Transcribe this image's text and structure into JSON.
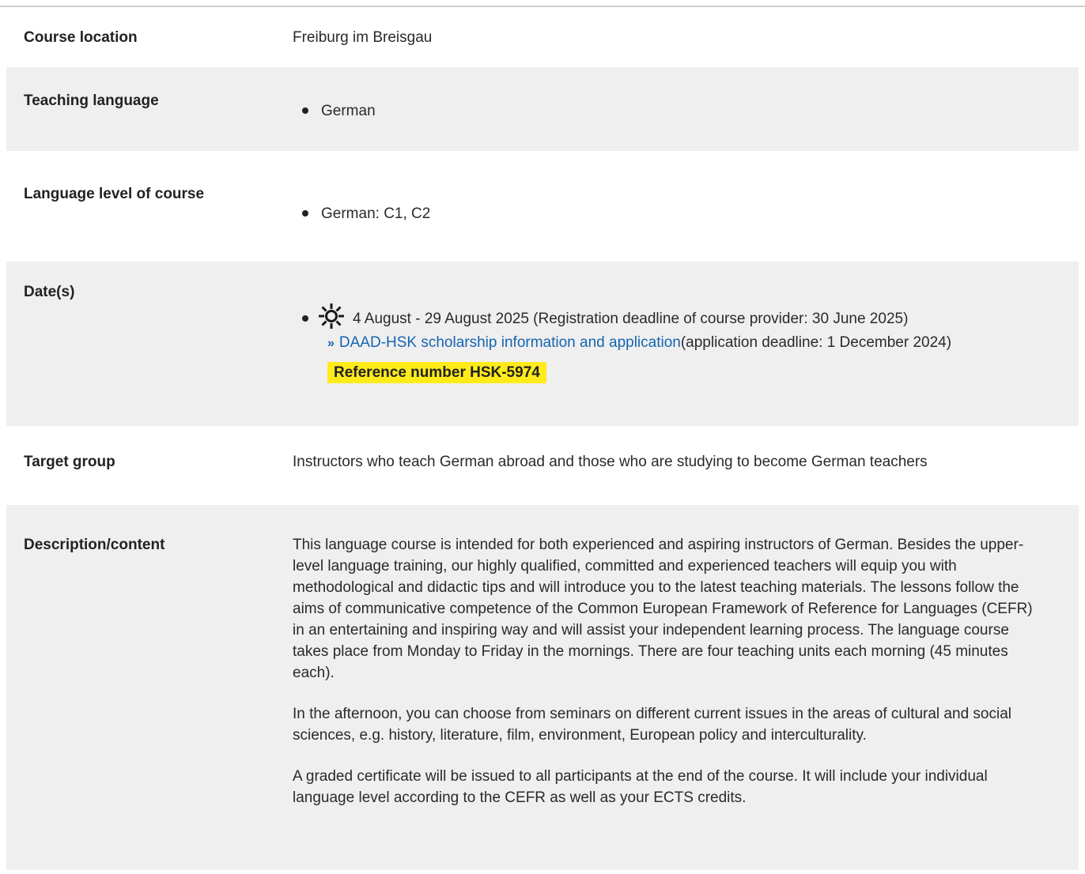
{
  "rows": {
    "location": {
      "label": "Course location",
      "value": "Freiburg im Breisgau"
    },
    "teaching_language": {
      "label": "Teaching language",
      "items": [
        "German"
      ]
    },
    "language_level": {
      "label": "Language level of course",
      "items": [
        "German: C1, C2"
      ]
    },
    "dates": {
      "label": "Date(s)",
      "icon": "sun-icon",
      "date_text": "4 August - 29 August 2025 (Registration deadline of course provider: 30 June 2025)",
      "link_arrow": "»",
      "link_text": "DAAD-HSK scholarship information and application",
      "link_suffix": "(application deadline: 1 December 2024)",
      "reference": "Reference number HSK-5974"
    },
    "target_group": {
      "label": "Target group",
      "value": "Instructors who teach German abroad and those who are studying to become German teachers"
    },
    "description": {
      "label": "Description/content",
      "paragraphs": [
        "This language course is intended for both experienced and aspiring instructors of German. Besides the upper-level language training, our highly qualified, committed and experienced teachers will equip you with methodological and didactic tips and will introduce you to the latest teaching materials. The lessons follow the aims of communicative competence of the Common European Framework of Reference for Languages (CEFR) in an entertaining and inspiring way and will assist your independent learning process. The language course takes place from Monday to Friday in the mornings. There are four teaching units each morning (45 minutes each).",
        "In the afternoon, you can choose from seminars on different current issues in the areas of cultural and social sciences, e.g. history, literature, film, environment, European policy and interculturality.",
        "A graded certificate will be issued to all participants at the end of the course. It will include your individual language level according to the CEFR as well as your ECTS credits."
      ]
    }
  },
  "colors": {
    "shade": "#efefef",
    "link": "#1565b0",
    "highlight": "#ffeb1a",
    "border": "#cfcfcf"
  }
}
